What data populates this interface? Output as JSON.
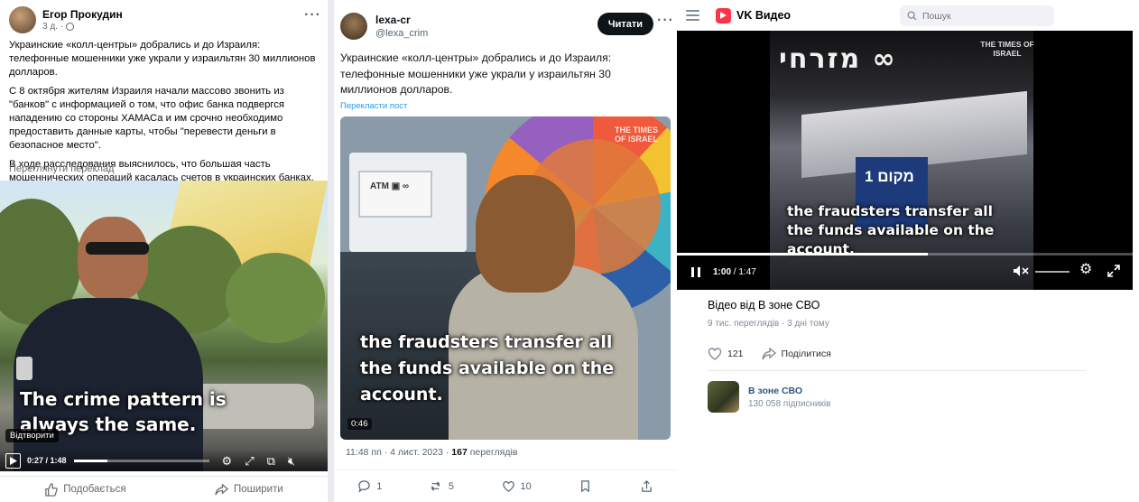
{
  "facebook": {
    "author": "Егор Прокудин",
    "time": "3 д.",
    "paragraphs": [
      "Украинские «колл-центры» добрались и до Израиля: телефонные мошенники уже украли у израильтян 30 миллионов долларов.",
      "С 8 октября жителям Израиля начали массово звонить из \"банков\" с информацией о том, что офис банка подвергся нападению со стороны ХАМАСа и им срочно необходимо предоставить данные карты, чтобы \"перевести деньги в безопасное место\".",
      "В ходе расследования выяснилось, что большая часть мошеннических операций касалась счетов в украинских банках."
    ],
    "translate_link": "Переглянути переклад",
    "video": {
      "caption": "The crime pattern is always the same.",
      "tooltip": "Відтворити",
      "current_time": "0:27",
      "duration": "1:48",
      "progress": 0.25
    },
    "actions": {
      "like": "Подобається",
      "share": "Поширити"
    }
  },
  "twitter": {
    "name": "lexa-cr",
    "handle": "@lexa_crim",
    "read_button": "Читати",
    "text": "Украинские «колл-центры» добрались и до Израиля: телефонные мошенники уже украли у израильтян 30 миллионов долларов.",
    "translate_link": "Перекласти пост",
    "video": {
      "caption": "the fraudsters transfer all the funds available on the account.",
      "watermark": "THE TIMES OF ISRAEL",
      "duration": "0:46"
    },
    "meta_time": "11:48 пп · 4 лист. 2023 · ",
    "meta_views_count": "167",
    "meta_views_label": " переглядів",
    "counts": {
      "replies": "1",
      "reposts": "5",
      "likes": "10"
    }
  },
  "vk": {
    "brand": "VK Видео",
    "search_placeholder": "Пошук",
    "video": {
      "caption": "the fraudsters transfer all the funds available on the account.",
      "watermark": "THE TIMES OF ISRAEL",
      "current_time": "1:00",
      "duration": "1:47",
      "progress": 0.55
    },
    "title": "Відео від В зоне СВО",
    "views": "9 тис. переглядів",
    "posted": "3 дні тому",
    "stats_separator": " · ",
    "likes": "121",
    "share": "Поділитися",
    "channel_name": "В зоне СВО",
    "channel_subs": "130 058 підписників"
  }
}
